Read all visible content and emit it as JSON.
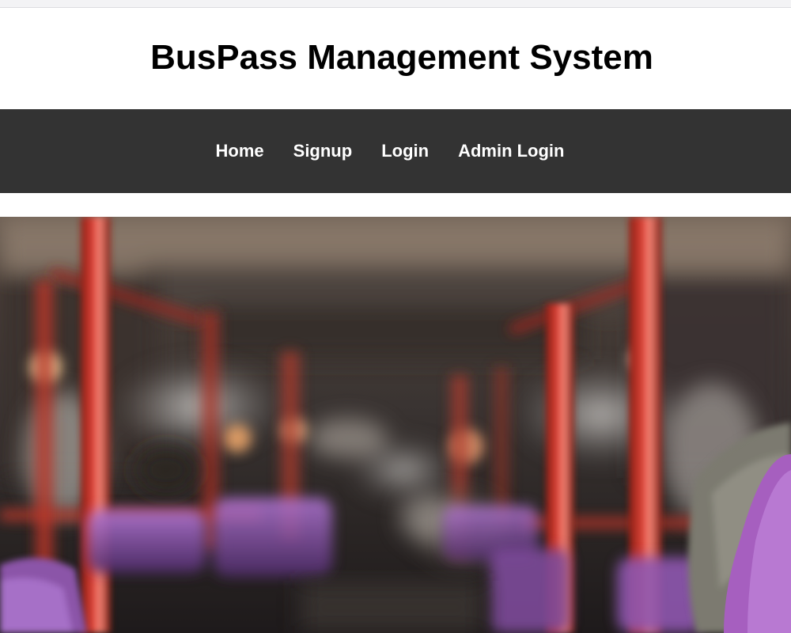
{
  "header": {
    "title": "BusPass Management System"
  },
  "nav": {
    "items": [
      {
        "label": "Home"
      },
      {
        "label": "Signup"
      },
      {
        "label": "Login"
      },
      {
        "label": "Admin Login"
      }
    ]
  },
  "hero": {
    "image": "blurred-bus-interior-photo"
  },
  "colors": {
    "navbar_bg": "#333333",
    "nav_text": "#ffffff",
    "title_text": "#000000",
    "page_bg": "#ffffff"
  }
}
